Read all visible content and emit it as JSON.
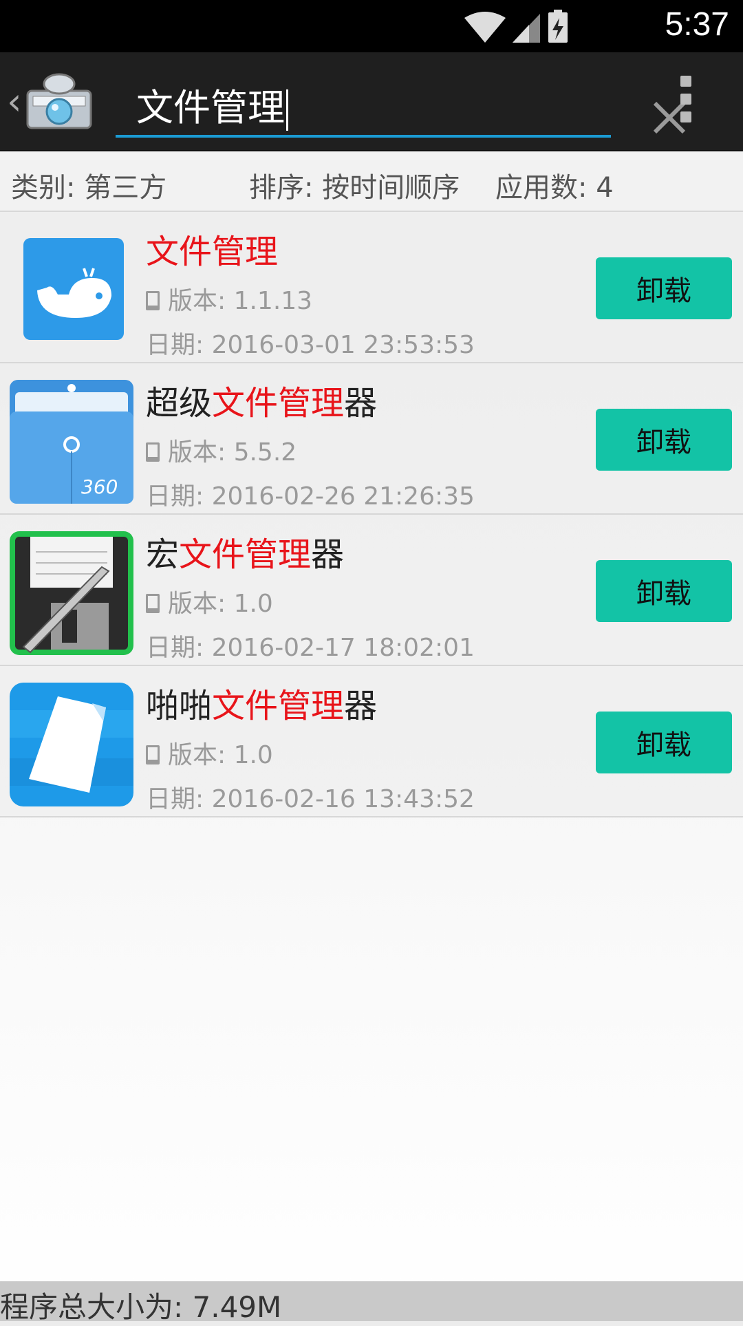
{
  "status_bar": {
    "time": "5:37",
    "icons": [
      "wifi-icon",
      "cell-signal-icon",
      "battery-charging-icon"
    ]
  },
  "action_bar": {
    "search_value": "文件管理",
    "icons": [
      "back-caret-icon",
      "app-logo-icon",
      "close-icon",
      "overflow-menu-icon"
    ]
  },
  "filter_bar": {
    "category": "类别: 第三方",
    "sort": "排序: 按时间顺序",
    "count": "应用数: 4"
  },
  "apps": [
    {
      "name_pre": "",
      "name_hl": "文件管理",
      "name_post": "",
      "version": "版本: 1.1.13",
      "date": "日期: 2016-03-01 23:53:53",
      "uninstall_label": "卸载"
    },
    {
      "name_pre": "超级",
      "name_hl": "文件管理",
      "name_post": "器",
      "version": "版本: 5.5.2",
      "date": "日期: 2016-02-26 21:26:35",
      "uninstall_label": "卸载"
    },
    {
      "name_pre": "宏",
      "name_hl": "文件管理",
      "name_post": "器",
      "version": "版本: 1.0",
      "date": "日期: 2016-02-17 18:02:01",
      "uninstall_label": "卸载"
    },
    {
      "name_pre": "啪啪",
      "name_hl": "文件管理",
      "name_post": "器",
      "version": "版本: 1.0",
      "date": "日期: 2016-02-16 13:43:52",
      "uninstall_label": "卸载"
    }
  ],
  "footer": {
    "total_size": "程序总大小为: 7.49M"
  },
  "colors": {
    "accent_button": "#13c3a6",
    "highlight_text": "#e8141a",
    "search_underline": "#1b9bd3"
  }
}
